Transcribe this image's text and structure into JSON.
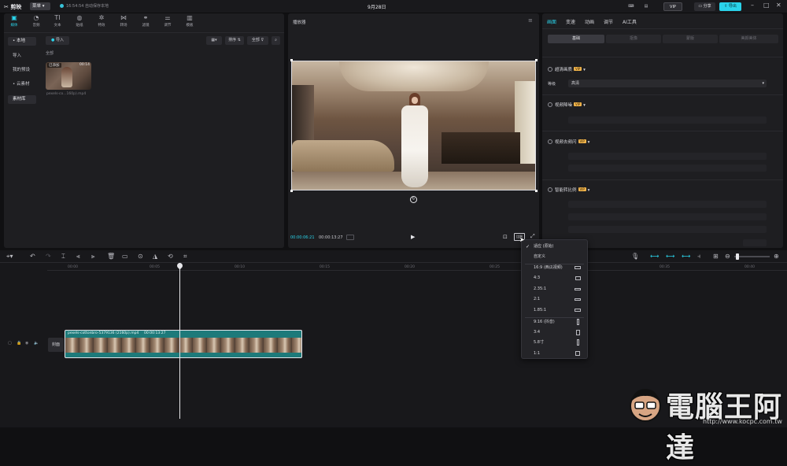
{
  "titlebar": {
    "app_name": "剪映",
    "menu_label": "菜单",
    "save_status": "16:54:54 自动保存本地",
    "date": "9月28日",
    "vip_badge": "VIP",
    "share_label": "分享",
    "export_label": "导出"
  },
  "toolbar": {
    "items": [
      {
        "label": "媒体",
        "icon": "media-icon"
      },
      {
        "label": "音频",
        "icon": "audio-icon"
      },
      {
        "label": "文本",
        "icon": "text-icon"
      },
      {
        "label": "贴纸",
        "icon": "sticker-icon"
      },
      {
        "label": "特效",
        "icon": "effects-icon"
      },
      {
        "label": "转场",
        "icon": "transition-icon"
      },
      {
        "label": "滤镜",
        "icon": "filter-icon"
      },
      {
        "label": "调节",
        "icon": "adjust-icon"
      },
      {
        "label": "模板",
        "icon": "template-icon"
      }
    ]
  },
  "media": {
    "sidebar": [
      "• 本地",
      "导入",
      "我的预设",
      "• 云素材",
      "素材库"
    ],
    "import_button": "导入",
    "sort_label": "排序",
    "filter_label": "全部",
    "section_label": "全部",
    "clip": {
      "badge": "已添加",
      "duration": "00:14",
      "filename": "pexels-co...160p).mp4"
    }
  },
  "player": {
    "title": "播放器",
    "current_time": "00:00:06:21",
    "total_time": "00:00:13:27",
    "ratio_label": "比例"
  },
  "properties": {
    "tabs": [
      "画面",
      "变速",
      "动画",
      "调节",
      "AI工具"
    ],
    "subtabs": [
      "基础",
      "抠像",
      "蒙版",
      "美颜美体"
    ],
    "rows": [
      {
        "label": "超清画质",
        "vip": "VIP"
      },
      {
        "label": "视频降噪",
        "vip": "VIP"
      },
      {
        "label": "视频去频闪",
        "vip": "VIP"
      },
      {
        "label": "智能转比例",
        "vip": "VIP"
      }
    ],
    "quality_label": "等级",
    "quality_value": "高清"
  },
  "timeline": {
    "ticks": [
      "00:00",
      "00:05",
      "00:10",
      "00:15",
      "00:20",
      "00:25",
      "00:30",
      "00:35",
      "00:40"
    ],
    "cover_label": "封面",
    "clip_name": "pexels-cottonbro-5379136 (2160p).mp4",
    "clip_duration": "00:00:13:27"
  },
  "ratio_menu": {
    "items": [
      {
        "label": "适应 (原始)",
        "checked": true
      },
      {
        "label": "自定义"
      },
      {
        "label": "16:9 (西瓜视频)",
        "shape": "wide"
      },
      {
        "label": "4:3",
        "shape": "std"
      },
      {
        "label": "2.35:1",
        "shape": "cinema"
      },
      {
        "label": "2:1",
        "shape": "cinema"
      },
      {
        "label": "1.85:1",
        "shape": "wide"
      },
      {
        "label": "9:16 (抖音)",
        "shape": "tall"
      },
      {
        "label": "3:4",
        "shape": "portrait"
      },
      {
        "label": "5.8寸",
        "shape": "tall"
      },
      {
        "label": "1:1",
        "shape": "square"
      }
    ]
  },
  "watermark": {
    "text": "電腦王阿達",
    "url": "http://www.kocpc.com.tw"
  }
}
